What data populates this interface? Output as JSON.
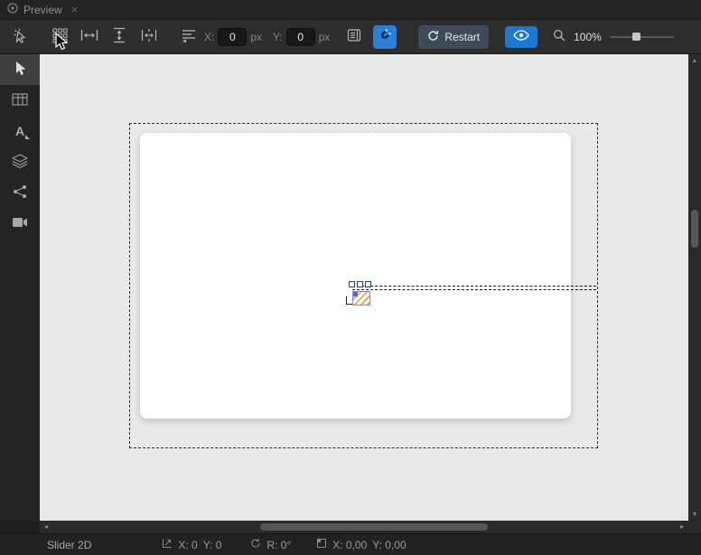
{
  "tab_bar": {
    "tabs": [
      {
        "label": "Preview",
        "icon": "play-circle-icon",
        "close_glyph": "×"
      }
    ]
  },
  "toolbar": {
    "x_label": "X:",
    "x_value": "0",
    "x_unit": "px",
    "y_label": "Y:",
    "y_value": "0",
    "y_unit": "px",
    "restart_label": "Restart",
    "zoom_value": "100%",
    "icons": [
      "picker-icon",
      "grid-icon",
      "fit-width-icon",
      "fit-height-icon",
      "fit-selection-icon",
      "anchors-icon",
      "edit-list-icon",
      "magnet-icon",
      "refresh-icon",
      "eye-icon",
      "zoom-icon"
    ],
    "magnet_active": true
  },
  "sidebar": {
    "items": [
      {
        "id": "select-tool",
        "icon": "cursor-icon",
        "active": true
      },
      {
        "id": "table-tool",
        "icon": "table-icon",
        "active": false
      },
      {
        "id": "text-tool",
        "icon": "text-style-icon",
        "glyph": "A",
        "active": false
      },
      {
        "id": "layers-tool",
        "icon": "layers-icon",
        "active": false
      },
      {
        "id": "connections-tool",
        "icon": "node-graph-icon",
        "active": false
      },
      {
        "id": "camera-tool",
        "icon": "camera-icon",
        "active": false
      }
    ]
  },
  "canvas": {
    "selected_component": "Slider 2D"
  },
  "scrollbars": {
    "up_glyph": "▴",
    "down_glyph": "▾",
    "left_glyph": "◂",
    "right_glyph": "▸"
  },
  "statusbar": {
    "selection_name": "Slider 2D",
    "pos_x": "X: 0",
    "pos_y": "Y: 0",
    "rotation": "R: 0°",
    "coord_x": "X: 0,00",
    "coord_y": "Y: 0,00"
  },
  "colors": {
    "accent_blue": "#1d78d4",
    "magnet_blue": "#2b7fd9",
    "restart_bg": "#3e4a57",
    "canvas_bg": "#e9e9e9",
    "toolbar_bg": "#2d2d2d",
    "dark_bg": "#1f1f1f"
  }
}
